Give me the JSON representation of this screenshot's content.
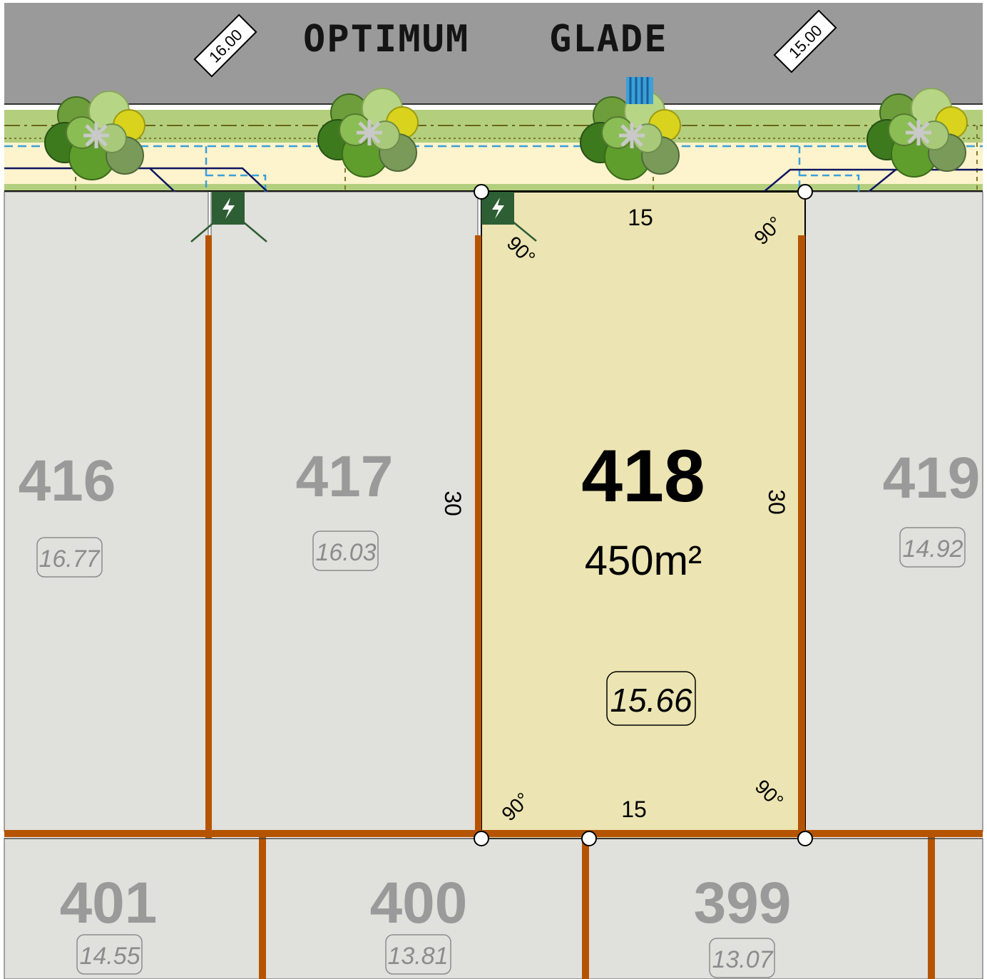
{
  "street": {
    "word1": "OPTIMUM",
    "word2": "GLADE",
    "road_width_left": "16.00",
    "road_width_right": "15.00"
  },
  "selected_lot": {
    "number": "418",
    "area": "450m²",
    "level": "15.66",
    "frontage_top": "15",
    "frontage_bottom": "15",
    "depth_left": "30",
    "depth_right": "30",
    "angle_top_left": "90°",
    "angle_top_right": "90°",
    "angle_bottom_left": "90°",
    "angle_bottom_right": "90°"
  },
  "neighbour_lots": {
    "lot_416": {
      "number": "416",
      "level": "16.77"
    },
    "lot_417": {
      "number": "417",
      "level": "16.03"
    },
    "lot_419": {
      "number": "419",
      "level": "14.92"
    },
    "lot_401": {
      "number": "401",
      "level": "14.55"
    },
    "lot_400": {
      "number": "400",
      "level": "13.81"
    },
    "lot_399": {
      "number": "399",
      "level": "13.07"
    }
  },
  "icons": [
    "electrical-pillar-icon",
    "water-meter-icon",
    "street-tree-icon",
    "survey-peg-icon"
  ],
  "colors": {
    "road": "#9a9a9a",
    "verge_green": "#b3cf7e",
    "verge_cream": "#fdf3cc",
    "lot_grey": "#e0e0dc",
    "selected_lot": "#ece4b2",
    "retaining_wall": "#b55400",
    "pillar_green": "#2e5e34",
    "service_blue": "#3aa0d8",
    "service_navy": "#0e1560"
  }
}
